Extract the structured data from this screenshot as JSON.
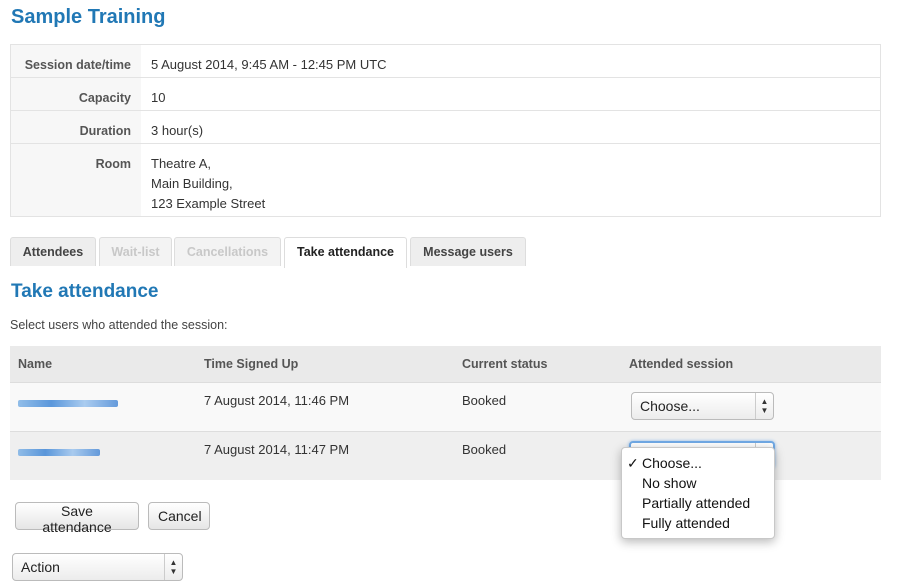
{
  "page_title": "Sample Training",
  "session_details": [
    {
      "label": "Session date/time",
      "value": [
        "5 August 2014, 9:45 AM - 12:45 PM UTC"
      ]
    },
    {
      "label": "Capacity",
      "value": [
        "10"
      ]
    },
    {
      "label": "Duration",
      "value": [
        "3 hour(s)"
      ]
    },
    {
      "label": "Room",
      "value": [
        "Theatre A,",
        "Main Building,",
        "123 Example Street"
      ]
    }
  ],
  "tabs": [
    {
      "label": "Attendees",
      "state": "normal"
    },
    {
      "label": "Wait-list",
      "state": "disabled"
    },
    {
      "label": "Cancellations",
      "state": "disabled"
    },
    {
      "label": "Take attendance",
      "state": "active"
    },
    {
      "label": "Message users",
      "state": "normal"
    }
  ],
  "section_title": "Take attendance",
  "instructions": "Select users who attended the session:",
  "table": {
    "headers": [
      "Name",
      "Time Signed Up",
      "Current status",
      "Attended session"
    ],
    "rows": [
      {
        "name": "",
        "time": "7 August 2014, 11:46 PM",
        "status": "Booked",
        "attended": "Choose..."
      },
      {
        "name": "",
        "time": "7 August 2014, 11:47 PM",
        "status": "Booked",
        "attended": ""
      }
    ]
  },
  "dropdown": {
    "options": [
      "Choose...",
      "No show",
      "Partially attended",
      "Fully attended"
    ],
    "selected": "Choose...",
    "check_glyph": "✓"
  },
  "buttons": {
    "save": "Save attendance",
    "cancel": "Cancel"
  },
  "action_select": {
    "value": "Action"
  },
  "colors": {
    "heading": "#2178b5",
    "focus": "#6fa8e4"
  }
}
